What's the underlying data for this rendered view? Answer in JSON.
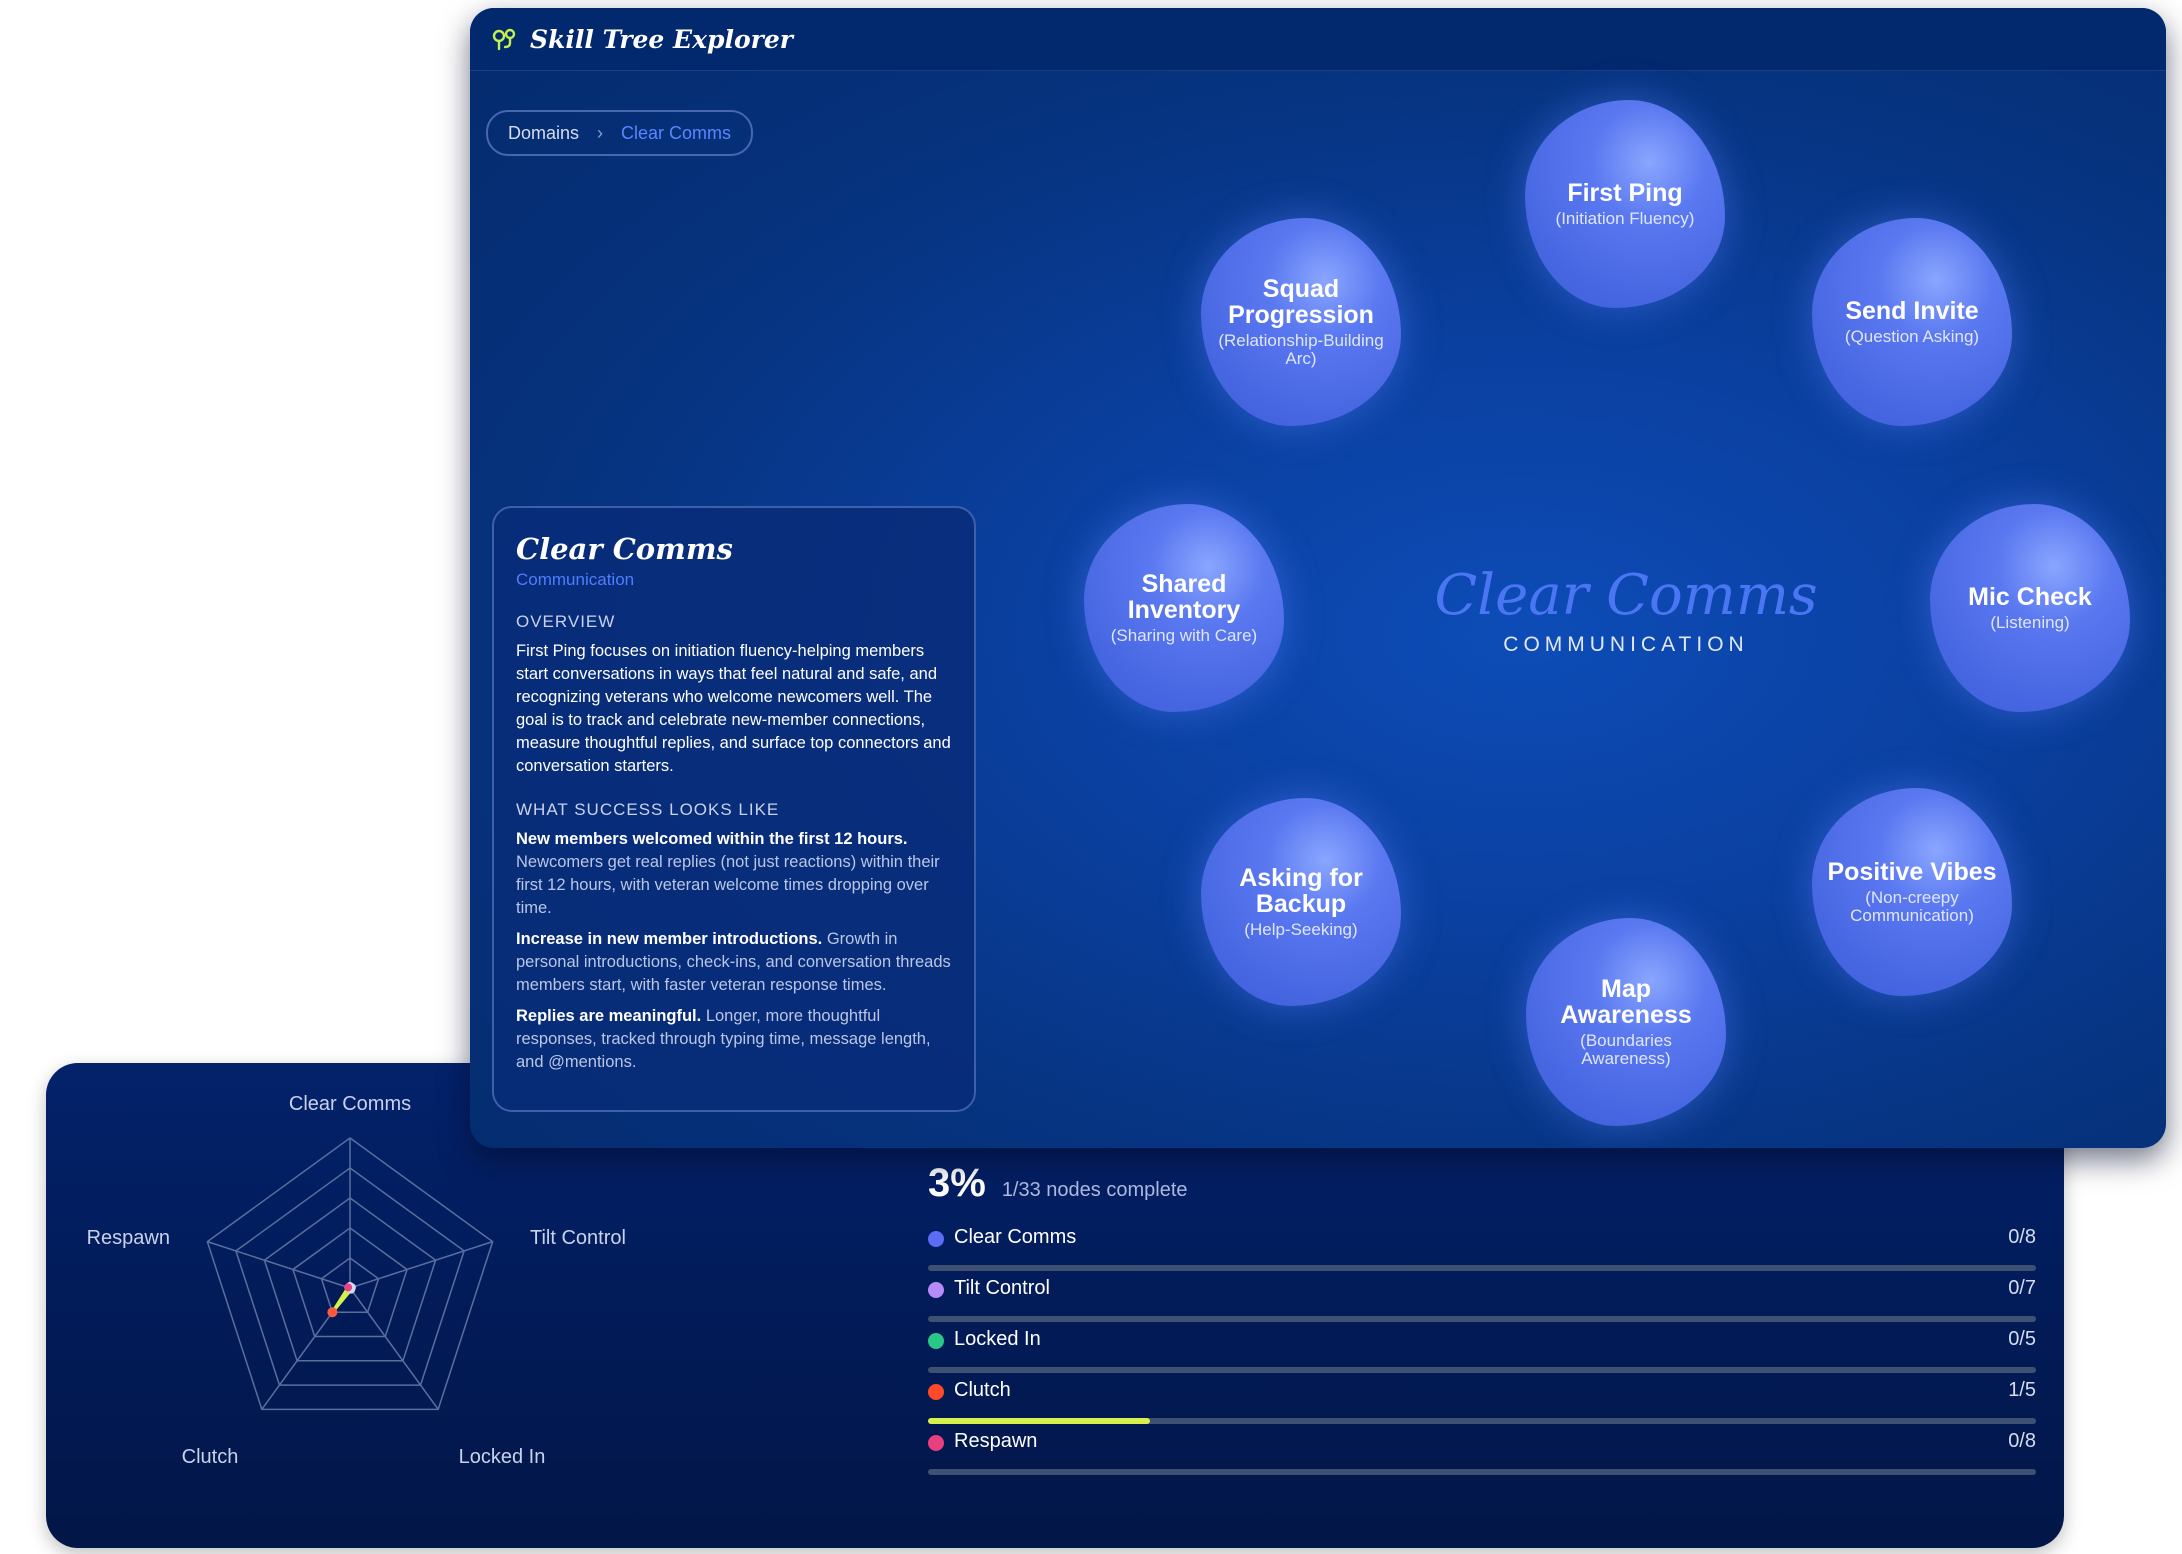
{
  "app": {
    "title": "Skill Tree Explorer"
  },
  "breadcrumb": {
    "items": [
      "Domains",
      "Clear Comms"
    ]
  },
  "info_card": {
    "title": "Clear Comms",
    "subtitle": "Communication",
    "overview_heading": "OVERVIEW",
    "overview_text": "First Ping focuses on initiation fluency-helping members start conversations in ways that feel natural and safe, and recognizing veterans who welcome newcomers well. The goal is to track and celebrate new-member connections, measure thoughtful replies, and surface top connectors and conversation starters.",
    "success_heading": "WHAT SUCCESS LOOKS LIKE",
    "criteria": [
      {
        "title": "New members welcomed within the first 12 hours.",
        "text": "Newcomers get real replies (not just reactions) within their first 12 hours, with veteran welcome times dropping over time."
      },
      {
        "title": "Increase in new member introductions.",
        "text": "Growth in personal introductions, check-ins, and conversation threads members start, with faster veteran response times."
      },
      {
        "title": "Replies are meaningful.",
        "text": "Longer, more thoughtful responses, tracked through typing time, message length, and @mentions."
      }
    ]
  },
  "center": {
    "title": "Clear Comms",
    "subtitle": "COMMUNICATION"
  },
  "nodes": [
    {
      "title": "First Ping",
      "subtitle": "(Initiation Fluency)"
    },
    {
      "title": "Send Invite",
      "subtitle": "(Question Asking)"
    },
    {
      "title": "Mic Check",
      "subtitle": "(Listening)"
    },
    {
      "title": "Positive Vibes",
      "subtitle": "(Non-creepy Communication)"
    },
    {
      "title": "Map Awareness",
      "subtitle": "(Boundaries Awareness)"
    },
    {
      "title": "Asking for Backup",
      "subtitle": "(Help-Seeking)"
    },
    {
      "title": "Shared Inventory",
      "subtitle": "(Sharing with Care)"
    },
    {
      "title": "Squad Progression",
      "subtitle": "(Relationship-Building Arc)"
    }
  ],
  "radar": {
    "axes": [
      "Clear Comms",
      "Tilt Control",
      "Locked In",
      "Clutch",
      "Respawn"
    ],
    "values": [
      0,
      0,
      0,
      0.2,
      0
    ],
    "point_colors": [
      "#d5d8f0",
      "#d5d8f0",
      "#d5d8f0",
      "#ff5a3c",
      "#e84387"
    ]
  },
  "progress": {
    "percent": "3%",
    "summary": "1/33 nodes complete",
    "domains": [
      {
        "name": "Clear Comms",
        "count": "0/8",
        "color": "#5b6cf5",
        "fraction": 0
      },
      {
        "name": "Tilt Control",
        "count": "0/7",
        "color": "#b58cf7",
        "fraction": 0
      },
      {
        "name": "Locked In",
        "count": "0/5",
        "color": "#28c987",
        "fraction": 0
      },
      {
        "name": "Clutch",
        "count": "1/5",
        "color": "#ff4a2a",
        "fraction": 0.2
      },
      {
        "name": "Respawn",
        "count": "0/8",
        "color": "#e8407e",
        "fraction": 0
      }
    ]
  }
}
